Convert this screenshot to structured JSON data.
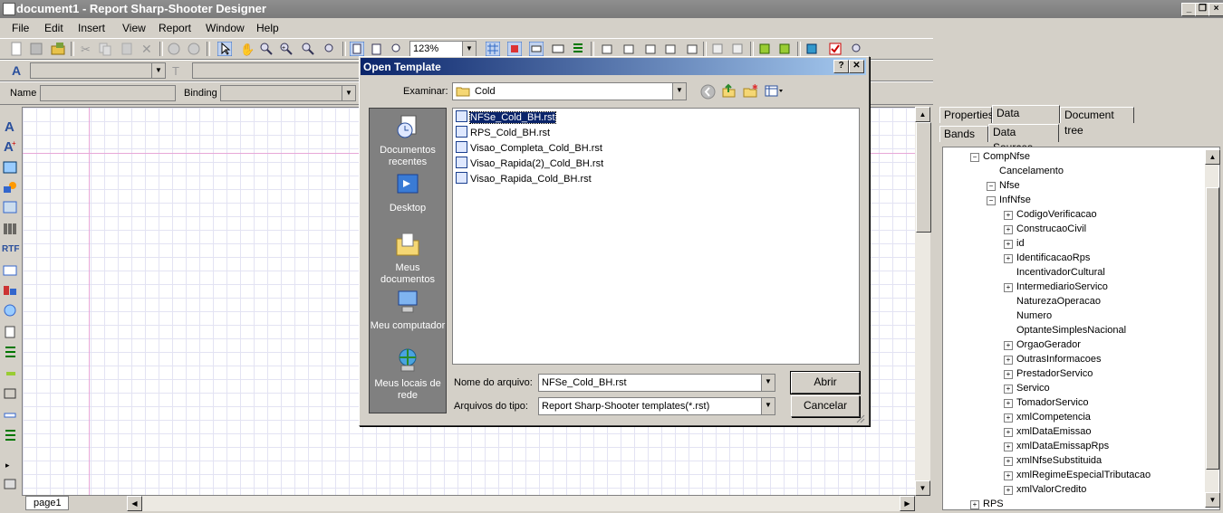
{
  "window": {
    "title": "document1 - Report Sharp-Shooter Designer"
  },
  "menu": [
    "File",
    "Edit",
    "Insert",
    "View",
    "Report",
    "Window",
    "Help"
  ],
  "toolbar": {
    "zoom": "123%"
  },
  "properties_bar": {
    "name_label": "Name",
    "binding_label": "Binding"
  },
  "left_tools": {
    "rtf_label": "RTF"
  },
  "canvas": {
    "page_tab": "page1"
  },
  "right_panel": {
    "tabs": [
      "Properties",
      "Data sources",
      "Document tree"
    ],
    "subtabs": [
      "Bands",
      "Data Sources"
    ],
    "tree": [
      {
        "label": "CompNfse",
        "expander": "−"
      },
      {
        "label": "Cancelamento",
        "expander": ""
      },
      {
        "label": "Nfse",
        "expander": "−"
      },
      {
        "label": "InfNfse",
        "expander": "−"
      },
      {
        "label": "CodigoVerificacao",
        "expander": "+"
      },
      {
        "label": "ConstrucaoCivil",
        "expander": "+"
      },
      {
        "label": "id",
        "expander": "+"
      },
      {
        "label": "IdentificacaoRps",
        "expander": "+"
      },
      {
        "label": "IncentivadorCultural",
        "expander": ""
      },
      {
        "label": "IntermediarioServico",
        "expander": "+"
      },
      {
        "label": "NaturezaOperacao",
        "expander": ""
      },
      {
        "label": "Numero",
        "expander": ""
      },
      {
        "label": "OptanteSimplesNacional",
        "expander": ""
      },
      {
        "label": "OrgaoGerador",
        "expander": "+"
      },
      {
        "label": "OutrasInformacoes",
        "expander": "+"
      },
      {
        "label": "PrestadorServico",
        "expander": "+"
      },
      {
        "label": "Servico",
        "expander": "+"
      },
      {
        "label": "TomadorServico",
        "expander": "+"
      },
      {
        "label": "xmlCompetencia",
        "expander": "+"
      },
      {
        "label": "xmlDataEmissao",
        "expander": "+"
      },
      {
        "label": "xmlDataEmissapRps",
        "expander": "+"
      },
      {
        "label": "xmlNfseSubstituida",
        "expander": "+"
      },
      {
        "label": "xmlRegimeEspecialTributacao",
        "expander": "+"
      },
      {
        "label": "xmlValorCredito",
        "expander": "+"
      },
      {
        "label": "RPS",
        "expander": "+"
      }
    ]
  },
  "dialog": {
    "title": "Open Template",
    "help": "?",
    "close": "✕",
    "look_in_label": "Examinar:",
    "look_in_value": "Cold",
    "places": [
      {
        "label": "Documentos recentes"
      },
      {
        "label": "Desktop"
      },
      {
        "label": "Meus documentos"
      },
      {
        "label": "Meu computador"
      },
      {
        "label": "Meus locais de rede"
      }
    ],
    "files": [
      "NFSe_Cold_BH.rst",
      "RPS_Cold_BH.rst",
      "Visao_Completa_Cold_BH.rst",
      "Visao_Rapida(2)_Cold_BH.rst",
      "Visao_Rapida_Cold_BH.rst"
    ],
    "filename_label": "Nome do arquivo:",
    "filename_value": "NFSe_Cold_BH.rst",
    "filetype_label": "Arquivos do tipo:",
    "filetype_value": "Report Sharp-Shooter templates(*.rst)",
    "open_button": "Abrir",
    "cancel_button": "Cancelar"
  }
}
